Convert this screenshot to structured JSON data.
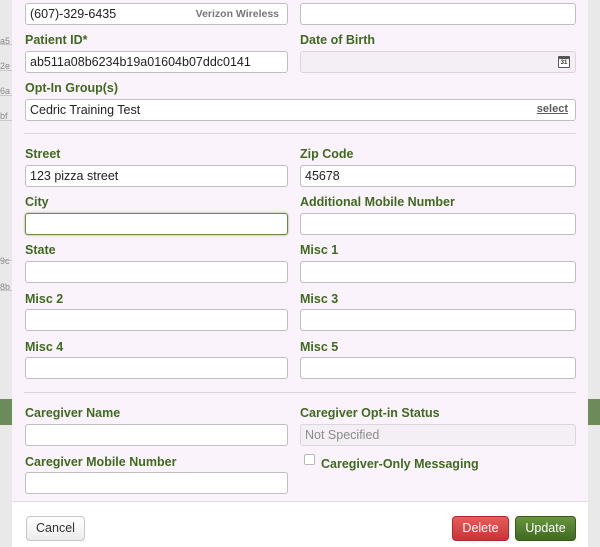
{
  "form": {
    "mobile": {
      "value": "(607)-329-6435",
      "carrier": "Verizon Wireless"
    },
    "top_right_field": {
      "value": ""
    },
    "patient_id": {
      "label": "Patient ID*",
      "value": "ab511a08b6234b19a01604b07ddc0141"
    },
    "date_of_birth": {
      "label": "Date of Birth",
      "value": ""
    },
    "opt_in_groups": {
      "label": "Opt-In Group(s)",
      "value": "Cedric Training Test",
      "select_label": "select"
    },
    "street": {
      "label": "Street",
      "value": "123 pizza street"
    },
    "zip_code": {
      "label": "Zip Code",
      "value": "45678"
    },
    "city": {
      "label": "City",
      "value": ""
    },
    "additional_mobile": {
      "label": "Additional Mobile Number",
      "value": ""
    },
    "state": {
      "label": "State",
      "value": ""
    },
    "misc1": {
      "label": "Misc 1",
      "value": ""
    },
    "misc2": {
      "label": "Misc 2",
      "value": ""
    },
    "misc3": {
      "label": "Misc 3",
      "value": ""
    },
    "misc4": {
      "label": "Misc 4",
      "value": ""
    },
    "misc5": {
      "label": "Misc 5",
      "value": ""
    },
    "caregiver_name": {
      "label": "Caregiver Name",
      "value": ""
    },
    "caregiver_optin_status": {
      "label": "Caregiver Opt-in Status",
      "value": "Not Specified"
    },
    "caregiver_mobile": {
      "label": "Caregiver Mobile Number",
      "value": ""
    },
    "caregiver_only_messaging": {
      "label": "Caregiver-Only Messaging",
      "checked": false
    }
  },
  "footer": {
    "cancel_label": "Cancel",
    "delete_label": "Delete",
    "update_label": "Update"
  },
  "backdrop": {
    "left_fragments": [
      "a5",
      "2e",
      "6a",
      "bf",
      "9c",
      "8b"
    ]
  },
  "icons": {
    "calendar": "calendar-icon"
  }
}
